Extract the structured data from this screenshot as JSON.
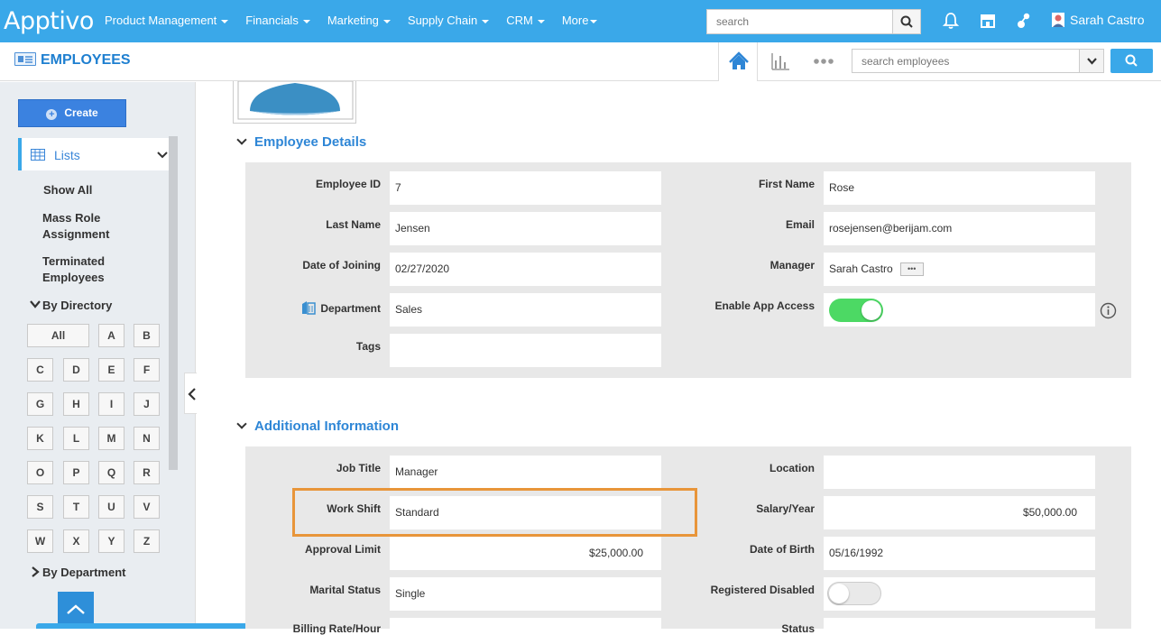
{
  "topnav": {
    "logo": "Apptivo",
    "menu": [
      "Product Management",
      "Financials",
      "Marketing",
      "Supply Chain",
      "CRM",
      "More"
    ],
    "search_placeholder": "search",
    "user_name": "Sarah Castro"
  },
  "subheader": {
    "app_title": "EMPLOYEES",
    "search_placeholder": "search employees"
  },
  "sidebar": {
    "create_label": "Create",
    "lists_label": "Lists",
    "links": [
      "Show All",
      "Mass Role Assignment",
      "Terminated Employees"
    ],
    "by_directory": "By Directory",
    "alphabet": [
      "All",
      "A",
      "B",
      "C",
      "D",
      "E",
      "F",
      "G",
      "H",
      "I",
      "J",
      "K",
      "L",
      "M",
      "N",
      "O",
      "P",
      "Q",
      "R",
      "S",
      "T",
      "U",
      "V",
      "W",
      "X",
      "Y",
      "Z"
    ],
    "by_department": "By Department"
  },
  "employee_details": {
    "title": "Employee Details",
    "employee_id_label": "Employee ID",
    "employee_id": "7",
    "first_name_label": "First Name",
    "first_name": "Rose",
    "last_name_label": "Last Name",
    "last_name": "Jensen",
    "email_label": "Email",
    "email": "rosejensen@berijam.com",
    "date_of_joining_label": "Date of Joining",
    "date_of_joining": "02/27/2020",
    "manager_label": "Manager",
    "manager": "Sarah Castro",
    "department_label": "Department",
    "department": "Sales",
    "enable_app_access_label": "Enable App Access",
    "enable_app_access": true,
    "tags_label": "Tags",
    "tags": ""
  },
  "additional_info": {
    "title": "Additional Information",
    "job_title_label": "Job Title",
    "job_title": "Manager",
    "location_label": "Location",
    "location": "",
    "work_shift_label": "Work Shift",
    "work_shift": "Standard",
    "salary_label": "Salary/Year",
    "salary": "$50,000.00",
    "approval_limit_label": "Approval Limit",
    "approval_limit": "$25,000.00",
    "dob_label": "Date of Birth",
    "dob": "05/16/1992",
    "marital_status_label": "Marital Status",
    "marital_status": "Single",
    "registered_disabled_label": "Registered Disabled",
    "registered_disabled": false,
    "billing_rate_label": "Billing Rate/Hour",
    "status_label": "Status"
  },
  "colors": {
    "primary": "#3aa8e9",
    "toggle_on": "#4cd964",
    "highlight": "#e8953a"
  }
}
